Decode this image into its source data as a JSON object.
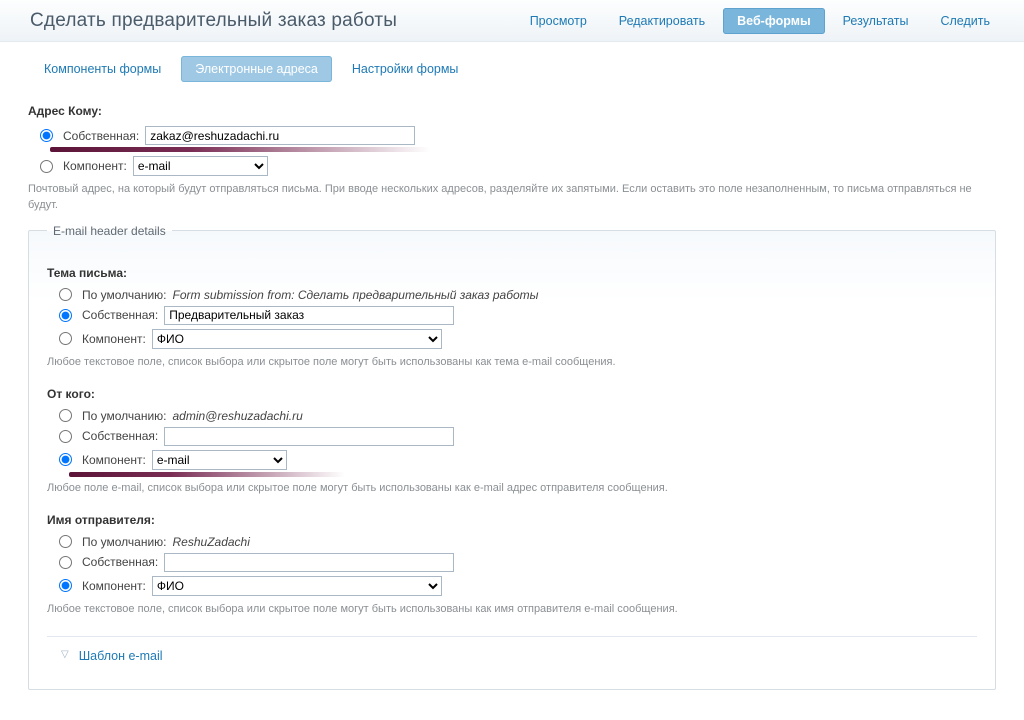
{
  "page_title": "Сделать предварительный заказ работы",
  "primary_tabs": {
    "view": "Просмотр",
    "edit": "Редактировать",
    "webforms": "Веб-формы",
    "results": "Результаты",
    "track": "Следить"
  },
  "sub_tabs": {
    "components": "Компоненты формы",
    "emails": "Электронные адреса",
    "settings": "Настройки формы"
  },
  "address_to": {
    "label": "Адрес Кому:",
    "custom_label": "Собственная:",
    "custom_value": "zakaz@reshuzadachi.ru",
    "component_label": "Компонент:",
    "component_value": "e-mail",
    "hint": "Почтовый адрес, на который будут отправляться письма. При вводе нескольких адресов, разделяйте их запятыми. Если оставить это поле незаполненным, то письма отправляться не будут."
  },
  "details_legend": "E-mail header details",
  "subject": {
    "label": "Тема письма:",
    "default_label": "По умолчанию:",
    "default_value": "Form submission from: Сделать предварительный заказ работы",
    "custom_label": "Собственная:",
    "custom_value": "Предварительный заказ",
    "component_label": "Компонент:",
    "component_value": "ФИО",
    "hint": "Любое текстовое поле, список выбора или скрытое поле могут быть использованы как тема e-mail сообщения."
  },
  "from": {
    "label": "От кого:",
    "default_label": "По умолчанию:",
    "default_value": "admin@reshuzadachi.ru",
    "custom_label": "Собственная:",
    "custom_value": "",
    "component_label": "Компонент:",
    "component_value": "e-mail",
    "hint": "Любое поле e-mail, список выбора или скрытое поле могут быть использованы как e-mail адрес отправителя сообщения."
  },
  "sender_name": {
    "label": "Имя отправителя:",
    "default_label": "По умолчанию:",
    "default_value": "ReshuZadachi",
    "custom_label": "Собственная:",
    "custom_value": "",
    "component_label": "Компонент:",
    "component_value": "ФИО",
    "hint": "Любое текстовое поле, список выбора или скрытое поле могут быть использованы как имя отправителя e-mail сообщения."
  },
  "template_section": "Шаблон e-mail"
}
